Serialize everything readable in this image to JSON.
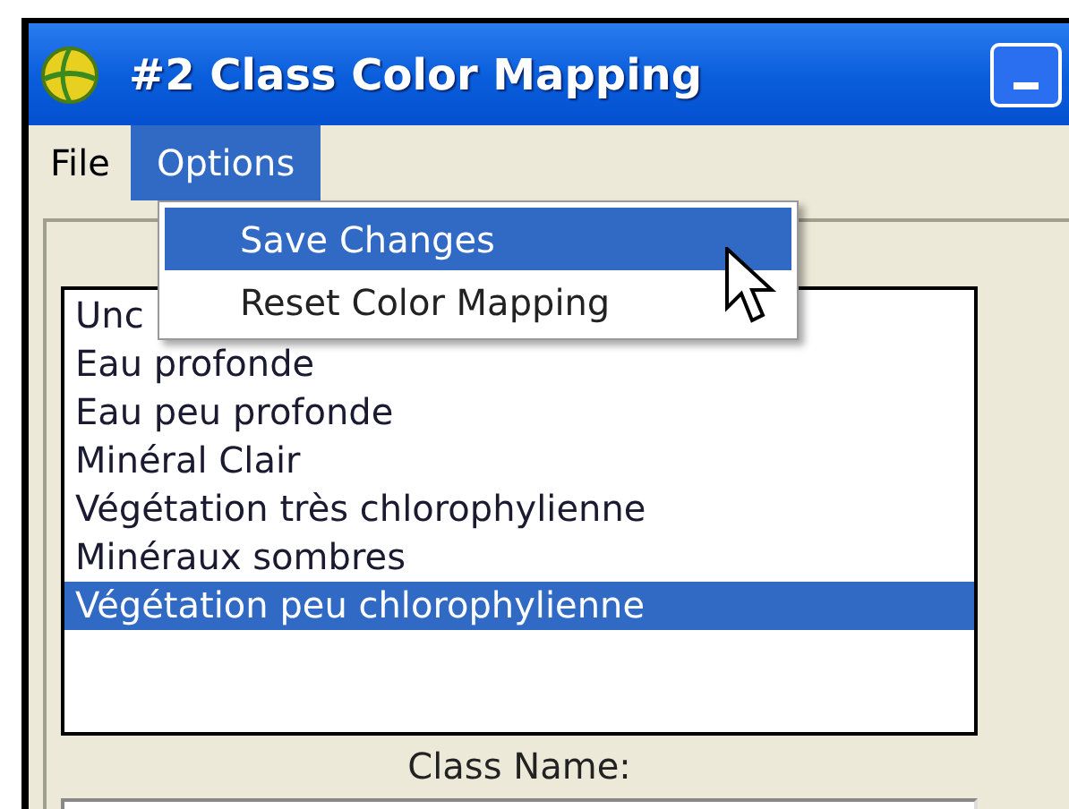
{
  "window": {
    "title": "#2 Class Color Mapping"
  },
  "menu_bar": [
    {
      "label": "File",
      "selected": false
    },
    {
      "label": "Options",
      "selected": true
    }
  ],
  "options_menu": [
    {
      "label": "Save Changes",
      "selected": true
    },
    {
      "label": "Reset Color Mapping",
      "selected": false
    }
  ],
  "class_list": [
    {
      "label": "Unc",
      "selected": false
    },
    {
      "label": "Eau profonde",
      "selected": false
    },
    {
      "label": "Eau peu profonde",
      "selected": false
    },
    {
      "label": "Minéral Clair",
      "selected": false
    },
    {
      "label": "Végétation très chlorophylienne",
      "selected": false
    },
    {
      "label": "Minéraux sombres",
      "selected": false
    },
    {
      "label": "Végétation peu chlorophylienne",
      "selected": true
    }
  ],
  "class_name": {
    "label": "Class Name:"
  }
}
